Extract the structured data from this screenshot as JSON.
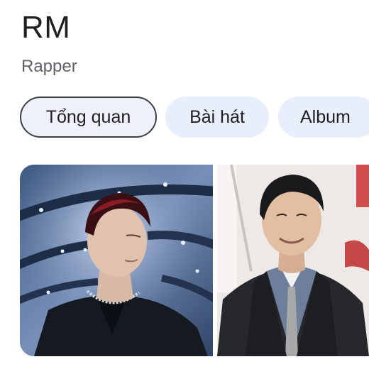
{
  "header": {
    "title": "RM",
    "subtitle": "Rapper"
  },
  "tabs": [
    {
      "label": "Tổng quan",
      "selected": true
    },
    {
      "label": "Bài hát",
      "selected": false
    },
    {
      "label": "Album",
      "selected": false
    }
  ],
  "images": [
    {
      "icon": "photo-portrait"
    },
    {
      "icon": "photo-portrait"
    }
  ],
  "colors": {
    "chip_bg": "#e9eefb",
    "chip_border": "#3c4043",
    "title": "#1f1f1f",
    "subtitle": "#5f6368"
  }
}
